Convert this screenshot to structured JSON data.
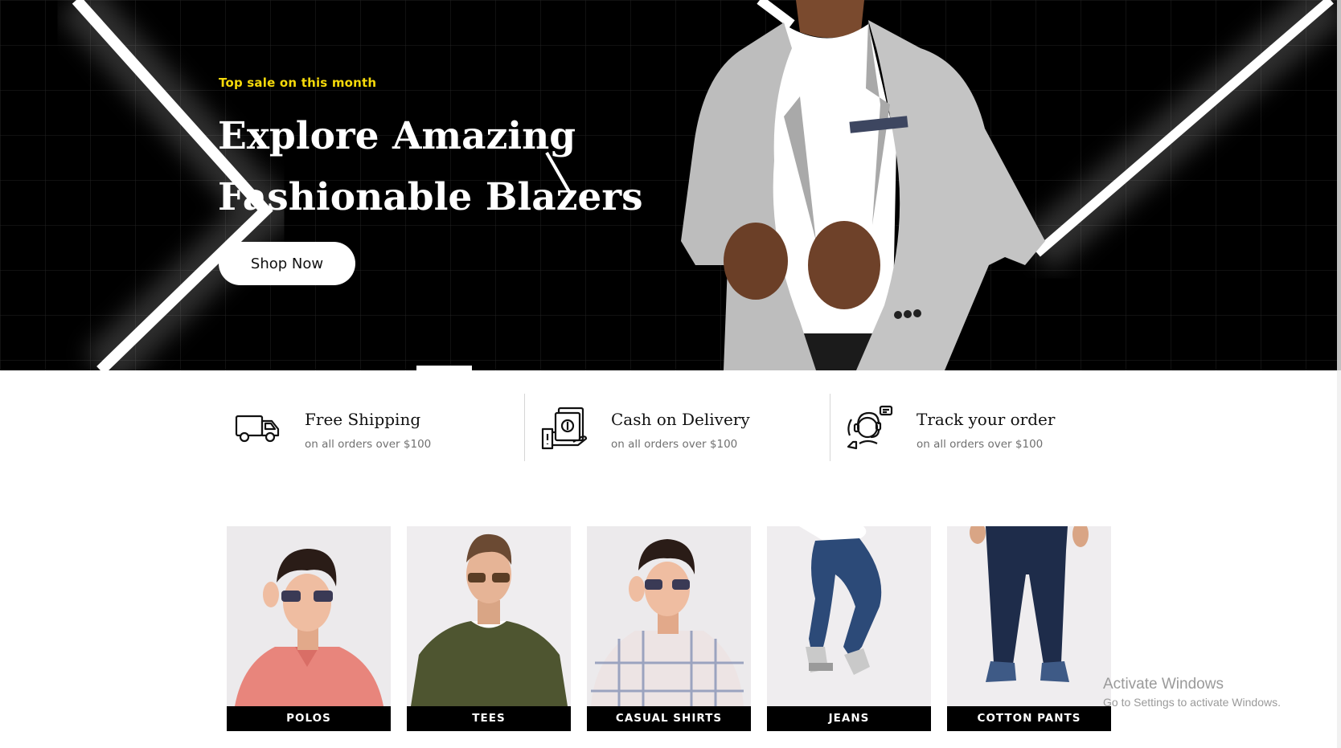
{
  "hero": {
    "eyebrow": "Top sale on this month",
    "title_line1": "Explore Amazing",
    "title_line2": "Fashionable Blazers",
    "button_label": "Shop Now",
    "eyebrow_color": "#f5d90a"
  },
  "features": [
    {
      "icon": "delivery-truck-icon",
      "title": "Free Shipping",
      "subtitle": "on all orders over $100"
    },
    {
      "icon": "cash-payment-icon",
      "title": "Cash on Delivery",
      "subtitle": "on all orders over $100"
    },
    {
      "icon": "customer-support-icon",
      "title": "Track your order",
      "subtitle": "on all orders over $100"
    }
  ],
  "categories": [
    {
      "label": "POLOS"
    },
    {
      "label": "TEES"
    },
    {
      "label": "CASUAL SHIRTS"
    },
    {
      "label": "JEANS"
    },
    {
      "label": "COTTON PANTS"
    }
  ],
  "watermark": {
    "title": "Activate Windows",
    "subtitle": "Go to Settings to activate Windows."
  }
}
